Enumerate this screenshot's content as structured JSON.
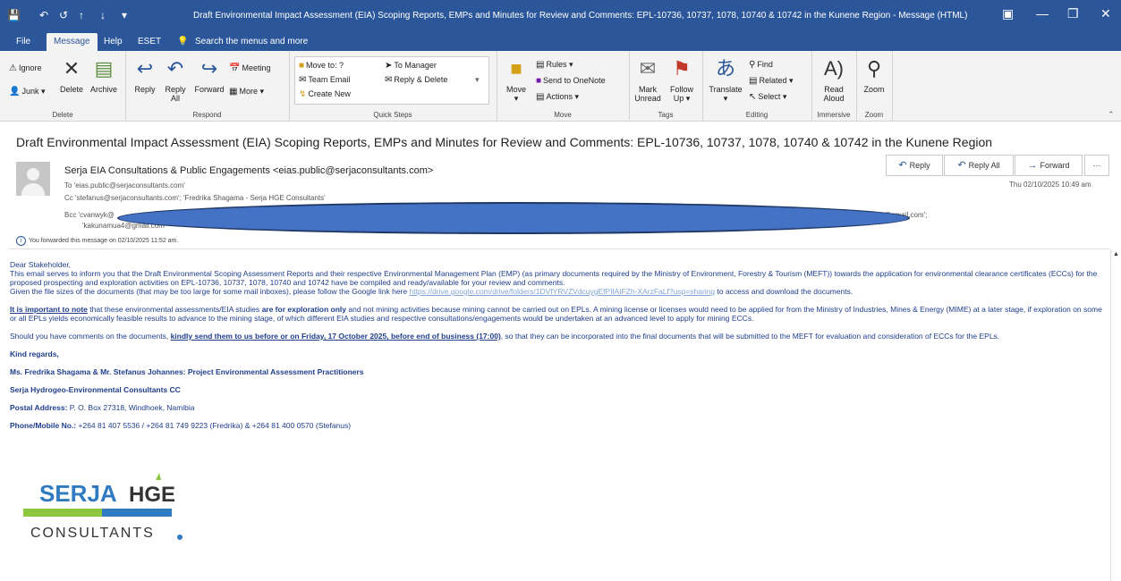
{
  "window": {
    "title": "Draft Environmental Impact Assessment (EIA) Scoping Reports, EMPs and Minutes for Review and Comments: EPL-10736, 10737, 1078, 10740 & 10742 in the Kunene Region  -  Message (HTML)"
  },
  "tabs": [
    "File",
    "Message",
    "Help",
    "ESET"
  ],
  "search_label": "Search the menus and more",
  "ribbon": {
    "delete": {
      "ignore": "Ignore",
      "junk": "Junk",
      "delete": "Delete",
      "archive": "Archive",
      "label": "Delete"
    },
    "respond": {
      "reply": "Reply",
      "reply_all_1": "Reply",
      "reply_all_2": "All",
      "forward": "Forward",
      "meeting": "Meeting",
      "more": "More",
      "label": "Respond"
    },
    "quick_steps": {
      "items": [
        "Move to: ?",
        "Team Email",
        "Create New",
        "To Manager",
        "Reply & Delete"
      ],
      "label": "Quick Steps"
    },
    "move": {
      "move": "Move",
      "rules": "Rules",
      "onenote": "Send to OneNote",
      "actions": "Actions",
      "label": "Move"
    },
    "tags": {
      "unread_1": "Mark",
      "unread_2": "Unread",
      "follow_1": "Follow",
      "follow_2": "Up",
      "label": "Tags"
    },
    "editing": {
      "translate": "Translate",
      "find": "Find",
      "related": "Related",
      "select": "Select",
      "label": "Editing"
    },
    "immersive": {
      "read_1": "Read",
      "read_2": "Aloud",
      "label": "Immersive"
    },
    "zoom": {
      "zoom": "Zoom",
      "label": "Zoom"
    }
  },
  "message": {
    "subject": "Draft Environmental Impact Assessment (EIA) Scoping Reports, EMPs and Minutes for Review and Comments: EPL-10736, 10737, 1078, 10740 & 10742 in the Kunene Region",
    "from": "Serja EIA Consultations & Public Engagements <eias.public@serjaconsultants.com>",
    "to": "To   'eias.public@serjaconsultants.com'",
    "cc": "Cc   'stefanus@serjaconsultants.com'; 'Fredrika Shagama - Serja HGE Consultants'",
    "bcc": "Bcc   'cvanwyk@",
    "bcc_tail": "@gmail.com';",
    "bcc2": "'kakunamua4@gmail.com'",
    "date": "Thu 02/10/2025 10:49 am",
    "forwarded_note": "You forwarded this message on 02/10/2025 11:52 am.",
    "actions": {
      "reply": "Reply",
      "reply_all": "Reply All",
      "forward": "Forward",
      "more": "···"
    }
  },
  "body": {
    "greeting": "Dear Stakeholder,",
    "p1": "This email serves to inform you that the Draft Environmental Scoping Assessment Reports and their respective Environmental Management Plan (EMP) (as primary documents required by the Ministry of Environment, Forestry & Tourism (MEFT)) towards the application for environmental clearance certificates (ECCs) for the proposed prospecting and exploration activities on EPL-10736, 10737, 1078, 10740 and 10742 have be compiled and ready/available for your review and comments.",
    "p1b_pre": "Given the file sizes of the documents (that may be too large for some mail inboxes), please follow the Google link here ",
    "p1b_link": "https://drive.google.com/drive/folders/1DVfYRVZVdcuygEfPIlAIFZh-XArzFaLf?usp=sharing",
    "p1b_post": " to access and download the documents.",
    "p2_u": "It is important to note",
    "p2_a": " that these environmental assessments/EIA studies ",
    "p2_b": "are for exploration only",
    "p2_c": " and not mining activities because mining cannot be carried out on EPLs. A mining license or licenses would need to be applied for from the Ministry of Industries, Mines & Energy (MIME) at a later stage, if exploration on some or all EPLs yields economically feasible results to advance to the mining stage, of which different EIA studies and respective consultations/engagements would be undertaken at an advanced level to apply for mining ECCs.",
    "p3_a": "Should you have comments on the documents, ",
    "p3_u": "kindly send them to us before or on Friday, 17 October 2025, before end of business (17:00)",
    "p3_b": ", so that they can be incorporated into the final documents that will be submitted to the MEFT for evaluation and consideration of ECCs for the EPLs.",
    "regards": "Kind regards,",
    "sig_names": "Ms. Fredrika Shagama & Mr. Stefanus Johannes: Project Environmental Assessment Practitioners",
    "sig_company": "Serja Hydrogeo-Environmental Consultants CC",
    "sig_postal_label": "Postal Address:",
    "sig_postal": " P. O. Box 27318, Windhoek, Namibia",
    "sig_phone_label": "Phone/Mobile No.:",
    "sig_phone": " +264 81 407 5536 / +264 81 749 9223 (Fredrika) & +264 81 400 0570 (Stefanus)"
  },
  "logo": {
    "line1a": "SERJA",
    "line1b": "HGE",
    "line2": "CONSULTANTS"
  },
  "colors": {
    "titlebar": "#2b579a",
    "ribbon": "#f3f3f3",
    "body_text": "#1f3e8c",
    "redaction": "#4472c4",
    "logo_blue": "#2f7ac0",
    "logo_green": "#8dc63f"
  }
}
